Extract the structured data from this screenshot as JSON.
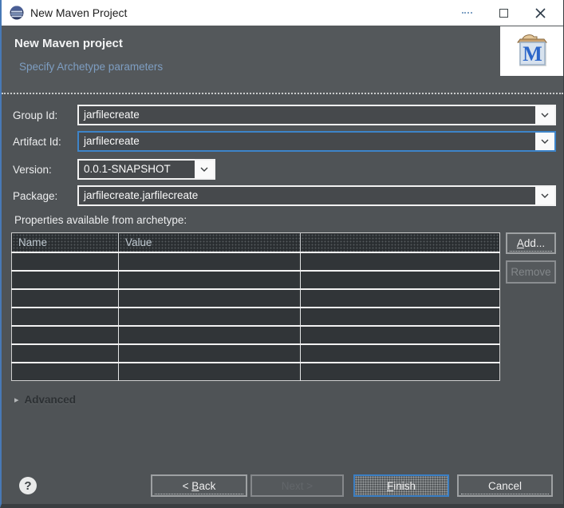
{
  "window": {
    "title": "New Maven Project",
    "icons": {
      "app": "eclipse-logo",
      "minimize": "minimize-dash",
      "maximize": "maximize-square",
      "close": "close-x",
      "dropdown": "chevron-down",
      "advanced_twistie": "▸",
      "help": "?"
    }
  },
  "header": {
    "title": "New Maven project",
    "subtitle": "Specify Archetype parameters",
    "logo": "maven-m-logo"
  },
  "form": {
    "fields": [
      {
        "label": "Group Id:",
        "value": "jarfilecreate"
      },
      {
        "label": "Artifact Id:",
        "value": "jarfilecreate"
      },
      {
        "label": "Version:",
        "value": "0.0.1-SNAPSHOT"
      },
      {
        "label": "Package:",
        "value": "jarfilecreate.jarfilecreate"
      }
    ],
    "properties_label": "Properties available from archetype:"
  },
  "table": {
    "columns": [
      "Name",
      "Value",
      ""
    ],
    "rows": [
      [
        "",
        "",
        ""
      ],
      [
        "",
        "",
        ""
      ],
      [
        "",
        "",
        ""
      ],
      [
        "",
        "",
        ""
      ],
      [
        "",
        "",
        ""
      ],
      [
        "",
        "",
        ""
      ],
      [
        "",
        "",
        ""
      ]
    ]
  },
  "side_buttons": {
    "add": {
      "pre": "",
      "key": "A",
      "post": "dd..."
    },
    "remove": {
      "label": "Remove"
    }
  },
  "advanced": {
    "label": "Advanced"
  },
  "footer": {
    "back": {
      "pre": "< ",
      "key": "B",
      "post": "ack"
    },
    "next": {
      "label": "Next >"
    },
    "finish": {
      "pre": "",
      "key": "F",
      "post": "inish"
    },
    "cancel": {
      "label": "Cancel"
    }
  },
  "colors": {
    "accent_blue": "#3D84C9",
    "finish_border": "#3B7FC4",
    "header_bg": "#54585B",
    "content_bg": "#4F5356",
    "field_bg": "#46494C",
    "table_row_bg": "#313538",
    "table_header_bg": "#2A2E31",
    "button_bg": "#55595C",
    "subtitle_text": "#7E9EC2",
    "titlebar_bg": "#FFFFFF",
    "left_border": "#4879B6"
  }
}
